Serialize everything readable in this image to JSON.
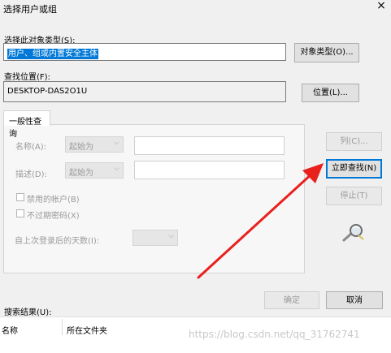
{
  "window": {
    "title": "选择用户或组",
    "close_icon": "×"
  },
  "object_type": {
    "label": "选择此对象类型(S):",
    "value": "用户、组或内置安全主体",
    "button": "对象类型(O)..."
  },
  "location": {
    "label": "查找位置(F):",
    "value": "DESKTOP-DAS2O1U",
    "button": "位置(L)..."
  },
  "tabs": [
    {
      "label": "一般性查询"
    }
  ],
  "query": {
    "name_label": "名称(A):",
    "name_mode": "起始为",
    "desc_label": "描述(D):",
    "desc_mode": "起始为",
    "disabled_accounts": "禁用的帐户(B)",
    "non_expiring_pw": "不过期密码(X)",
    "days_since_logon": "自上次登录后的天数(I):",
    "dropdown_arrow": "⌵"
  },
  "side_buttons": {
    "columns": "列(C)...",
    "find_now": "立即查找(N)",
    "stop": "停止(T)"
  },
  "footer": {
    "ok": "确定",
    "cancel": "取消"
  },
  "results": {
    "label": "搜索结果(U):",
    "columns": [
      "名称",
      "所在文件夹"
    ]
  },
  "watermark": "https://blog.csdn.net/qq_31762741",
  "colors": {
    "selection": "#0078d7",
    "annotation_arrow": "#e8211d"
  },
  "icons": {
    "search_icon": "magnifier"
  }
}
